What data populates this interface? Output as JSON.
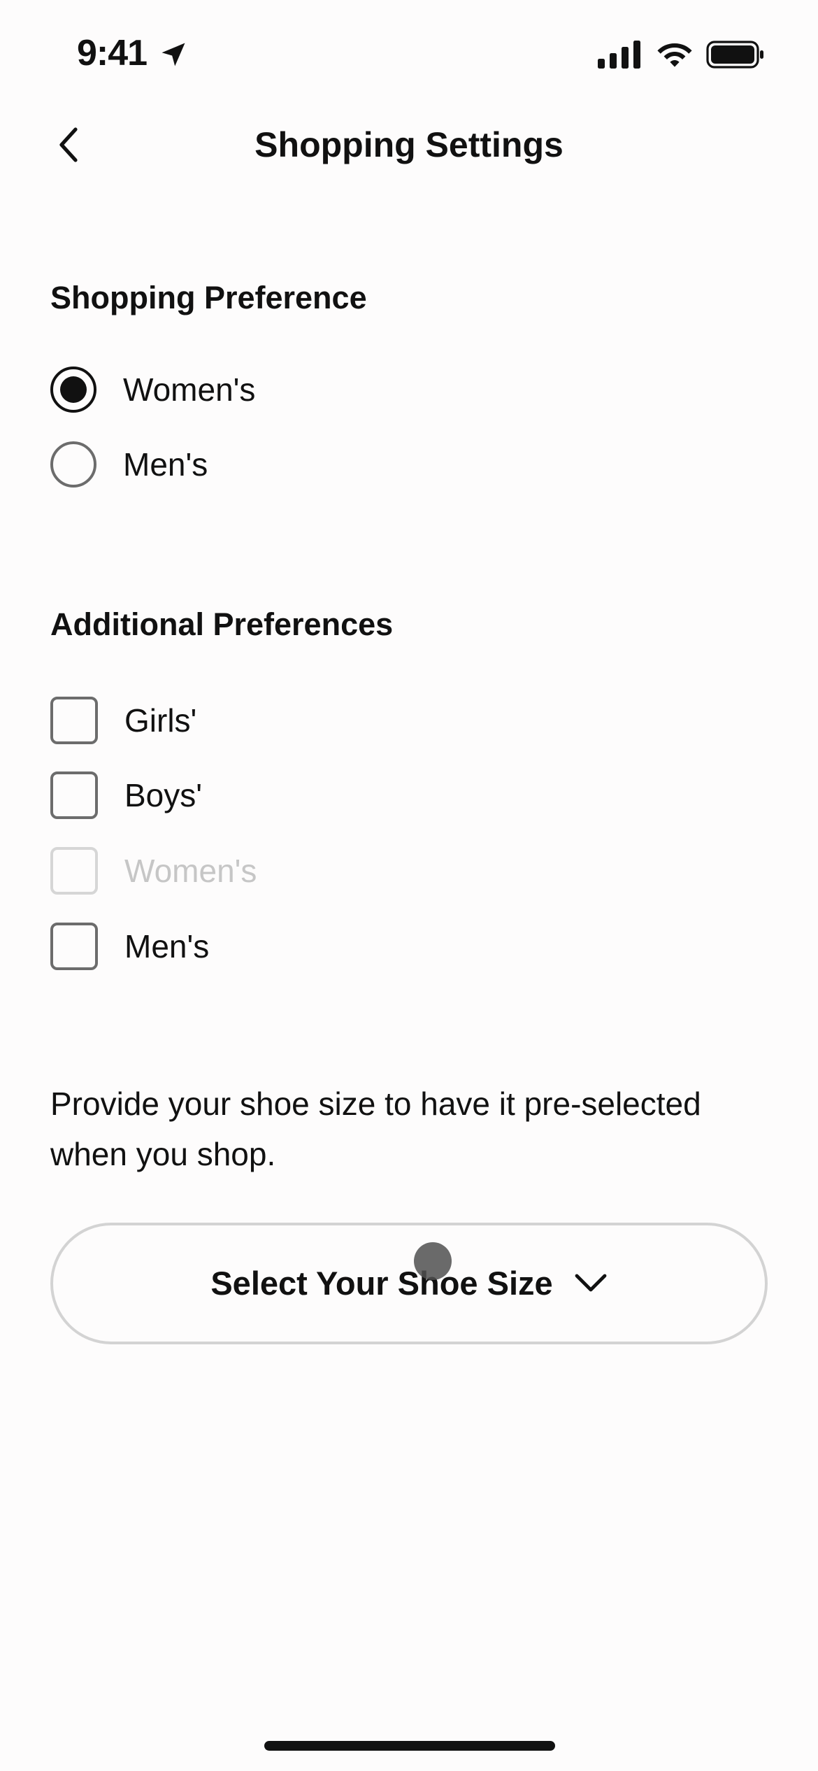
{
  "status_bar": {
    "time": "9:41"
  },
  "nav": {
    "title": "Shopping Settings"
  },
  "shopping_preference": {
    "title": "Shopping Preference",
    "options": [
      {
        "label": "Women's",
        "selected": true
      },
      {
        "label": "Men's",
        "selected": false
      }
    ]
  },
  "additional_preferences": {
    "title": "Additional Preferences",
    "options": [
      {
        "label": "Girls'",
        "checked": false,
        "disabled": false
      },
      {
        "label": "Boys'",
        "checked": false,
        "disabled": false
      },
      {
        "label": "Women's",
        "checked": false,
        "disabled": true
      },
      {
        "label": "Men's",
        "checked": false,
        "disabled": false
      }
    ]
  },
  "shoe_size": {
    "info": "Provide your shoe size to have it pre-selected when you shop.",
    "button_label": "Select Your Shoe Size"
  },
  "colors": {
    "background": "#fdfcfc",
    "text": "#111111",
    "disabled_text": "#c6c6c6",
    "control_border": "#6c6c6c",
    "button_border": "#d3d3d3"
  }
}
